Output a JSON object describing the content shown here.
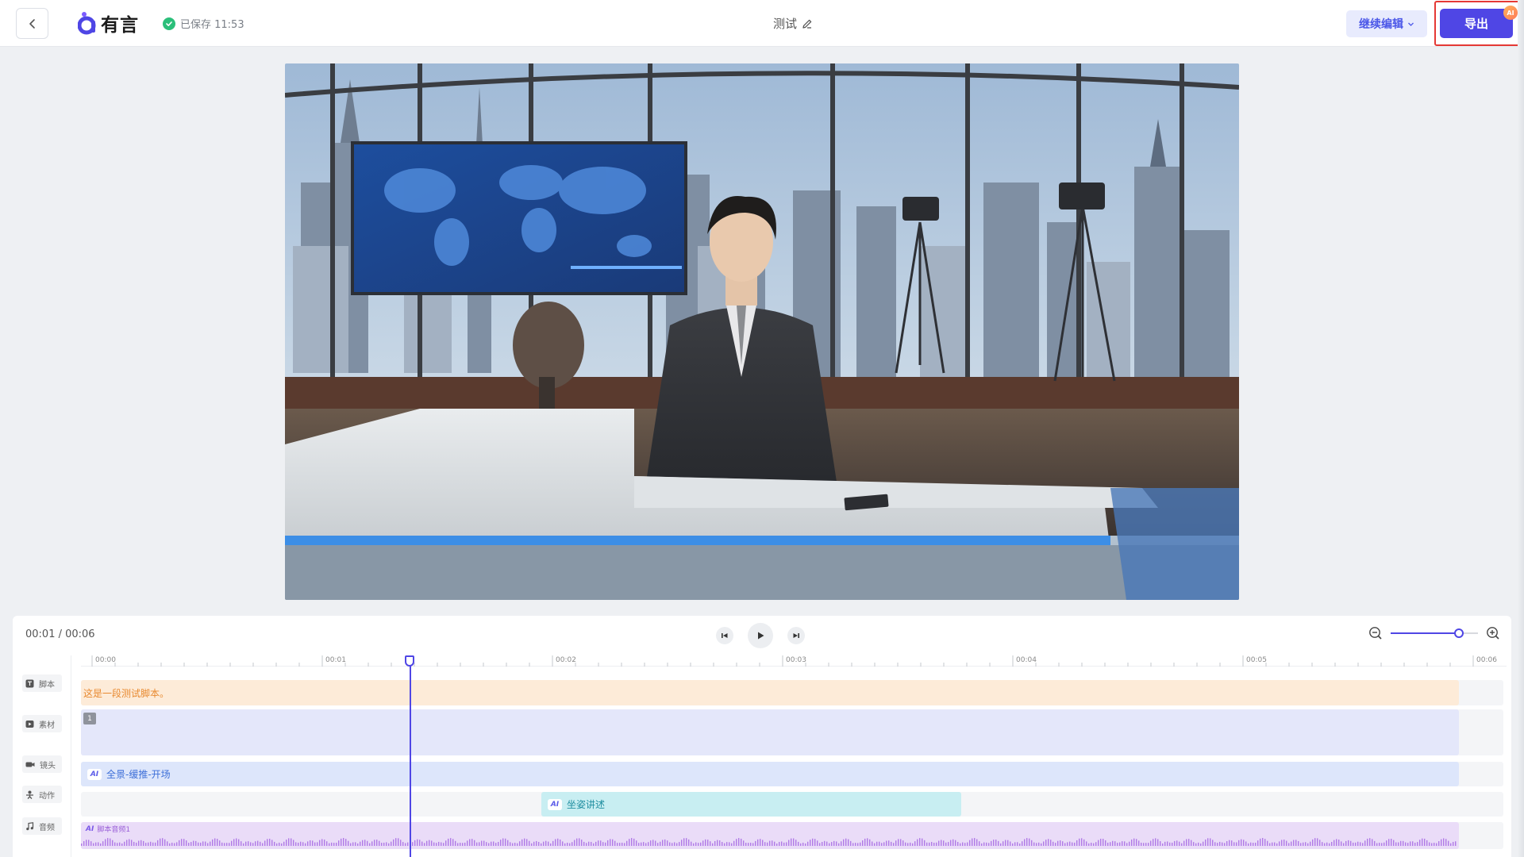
{
  "header": {
    "back_icon": "chevron-left-icon",
    "logo_text": "有言",
    "save_status": "已保存 11:53",
    "doc_title": "测试",
    "continue_label": "继续编辑",
    "export_label": "导出",
    "ai_badge": "AI"
  },
  "colors": {
    "brand": "#4f46e5",
    "saved_green": "#2bbf7a",
    "highlight_red": "#e53935"
  },
  "timeline": {
    "time_readout": "00:01 / 00:06",
    "zoom_level": 0.78,
    "ruler_ticks": [
      "00:00",
      "00:01",
      "00:02",
      "00:03",
      "00:04",
      "00:05",
      "00:06"
    ],
    "tracks": [
      {
        "key": "script",
        "label": "脚本",
        "icon": "text-icon"
      },
      {
        "key": "material",
        "label": "素材",
        "icon": "video-icon"
      },
      {
        "key": "camera",
        "label": "镜头",
        "icon": "camera-icon"
      },
      {
        "key": "motion",
        "label": "动作",
        "icon": "person-icon"
      },
      {
        "key": "audio",
        "label": "音频",
        "icon": "music-icon"
      }
    ],
    "clips": {
      "script_text": "这是一段测试脚本。",
      "material_badge": "1",
      "camera_ai": "AI",
      "camera_text": "全景-缓推-开场",
      "motion_ai": "AI",
      "motion_text": "坐姿讲述",
      "audio_ai": "AI",
      "audio_text": "脚本音频1"
    }
  }
}
